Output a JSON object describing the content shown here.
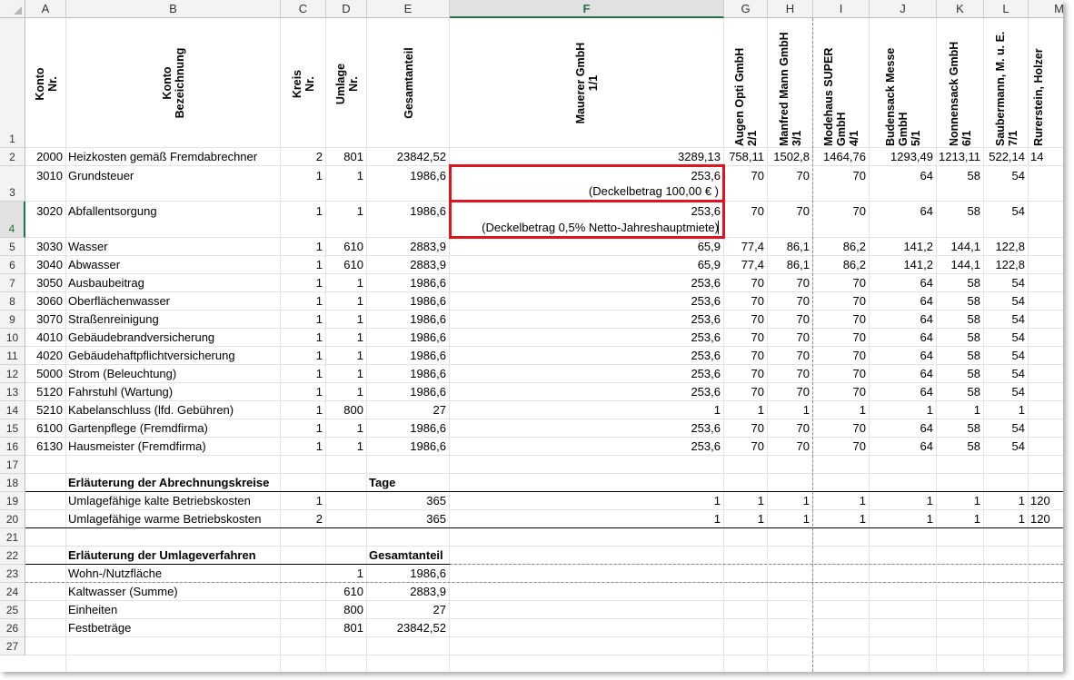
{
  "columns": [
    "A",
    "B",
    "C",
    "D",
    "E",
    "F",
    "G",
    "H",
    "I",
    "J",
    "K",
    "L",
    "M"
  ],
  "row_numbers": [
    "1",
    "2",
    "3",
    "4",
    "5",
    "6",
    "7",
    "8",
    "9",
    "10",
    "11",
    "12",
    "13",
    "14",
    "15",
    "16",
    "17",
    "18",
    "19",
    "20",
    "21",
    "22",
    "23",
    "24",
    "25",
    "26",
    "27"
  ],
  "header_row": {
    "a": "Konto\nNr.",
    "b": "Konto\nBezeichnung",
    "c": "Kreis\nNr.",
    "d": "Umlage\nNr.",
    "e": "Gesamtanteil",
    "f": "Mauerer GmbH\n1/1",
    "g": "Augen Opti GmbH\n2/1",
    "h": "Manfred Mann GmbH\n3/1",
    "i": "Modehaus SUPER\nGmbH\n4/1",
    "j": "Budensack Messe\nGmbH\n5/1",
    "k": "Nonnensack GmbH\n6/1",
    "l": "Saubermann, M. u. E.\n7/1",
    "m": "Rurerstein, Holzer"
  },
  "rows": [
    {
      "n": "2",
      "a": "2000",
      "b": "Heizkosten gemäß Fremdabrechner",
      "c": "2",
      "d": "801",
      "e": "23842,52",
      "f": "3289,13",
      "g": "758,11",
      "h": "1502,8",
      "i": "1464,76",
      "j": "1293,49",
      "k": "1213,11",
      "l": "522,14",
      "m": "14"
    },
    {
      "n": "3",
      "a": "3010",
      "b": "Grundsteuer",
      "c": "1",
      "d": "1",
      "e": "1986,6",
      "f": "253,6",
      "g": "70",
      "h": "70",
      "i": "70",
      "j": "64",
      "k": "58",
      "l": "54",
      "m": "",
      "note": "(Deckelbetrag 100,00 € )"
    },
    {
      "n": "4",
      "a": "3020",
      "b": "Abfallentsorgung",
      "c": "1",
      "d": "1",
      "e": "1986,6",
      "f": "253,6",
      "g": "70",
      "h": "70",
      "i": "70",
      "j": "64",
      "k": "58",
      "l": "54",
      "m": "",
      "note": "(Deckelbetrag 0,5% Netto-Jahreshauptmiete)"
    },
    {
      "n": "5",
      "a": "3030",
      "b": "Wasser",
      "c": "1",
      "d": "610",
      "e": "2883,9",
      "f": "65,9",
      "g": "77,4",
      "h": "86,1",
      "i": "86,2",
      "j": "141,2",
      "k": "144,1",
      "l": "122,8",
      "m": ""
    },
    {
      "n": "6",
      "a": "3040",
      "b": "Abwasser",
      "c": "1",
      "d": "610",
      "e": "2883,9",
      "f": "65,9",
      "g": "77,4",
      "h": "86,1",
      "i": "86,2",
      "j": "141,2",
      "k": "144,1",
      "l": "122,8",
      "m": ""
    },
    {
      "n": "7",
      "a": "3050",
      "b": "Ausbaubeitrag",
      "c": "1",
      "d": "1",
      "e": "1986,6",
      "f": "253,6",
      "g": "70",
      "h": "70",
      "i": "70",
      "j": "64",
      "k": "58",
      "l": "54",
      "m": ""
    },
    {
      "n": "8",
      "a": "3060",
      "b": "Oberflächenwasser",
      "c": "1",
      "d": "1",
      "e": "1986,6",
      "f": "253,6",
      "g": "70",
      "h": "70",
      "i": "70",
      "j": "64",
      "k": "58",
      "l": "54",
      "m": ""
    },
    {
      "n": "9",
      "a": "3070",
      "b": "Straßenreinigung",
      "c": "1",
      "d": "1",
      "e": "1986,6",
      "f": "253,6",
      "g": "70",
      "h": "70",
      "i": "70",
      "j": "64",
      "k": "58",
      "l": "54",
      "m": ""
    },
    {
      "n": "10",
      "a": "4010",
      "b": "Gebäudebrandversicherung",
      "c": "1",
      "d": "1",
      "e": "1986,6",
      "f": "253,6",
      "g": "70",
      "h": "70",
      "i": "70",
      "j": "64",
      "k": "58",
      "l": "54",
      "m": ""
    },
    {
      "n": "11",
      "a": "4020",
      "b": "Gebäudehaftpflichtversicherung",
      "c": "1",
      "d": "1",
      "e": "1986,6",
      "f": "253,6",
      "g": "70",
      "h": "70",
      "i": "70",
      "j": "64",
      "k": "58",
      "l": "54",
      "m": ""
    },
    {
      "n": "12",
      "a": "5000",
      "b": "Strom (Beleuchtung)",
      "c": "1",
      "d": "1",
      "e": "1986,6",
      "f": "253,6",
      "g": "70",
      "h": "70",
      "i": "70",
      "j": "64",
      "k": "58",
      "l": "54",
      "m": ""
    },
    {
      "n": "13",
      "a": "5120",
      "b": "Fahrstuhl (Wartung)",
      "c": "1",
      "d": "1",
      "e": "1986,6",
      "f": "253,6",
      "g": "70",
      "h": "70",
      "i": "70",
      "j": "64",
      "k": "58",
      "l": "54",
      "m": ""
    },
    {
      "n": "14",
      "a": "5210",
      "b": "Kabelanschluss (lfd. Gebühren)",
      "c": "1",
      "d": "800",
      "e": "27",
      "f": "1",
      "g": "1",
      "h": "1",
      "i": "1",
      "j": "1",
      "k": "1",
      "l": "1",
      "m": ""
    },
    {
      "n": "15",
      "a": "6100",
      "b": "Gartenpflege (Fremdfirma)",
      "c": "1",
      "d": "1",
      "e": "1986,6",
      "f": "253,6",
      "g": "70",
      "h": "70",
      "i": "70",
      "j": "64",
      "k": "58",
      "l": "54",
      "m": ""
    },
    {
      "n": "16",
      "a": "6130",
      "b": "Hausmeister (Fremdfirma)",
      "c": "1",
      "d": "1",
      "e": "1986,6",
      "f": "253,6",
      "g": "70",
      "h": "70",
      "i": "70",
      "j": "64",
      "k": "58",
      "l": "54",
      "m": ""
    },
    {
      "n": "17",
      "a": "",
      "b": "",
      "c": "",
      "d": "",
      "e": "",
      "f": "",
      "g": "",
      "h": "",
      "i": "",
      "j": "",
      "k": "",
      "l": "",
      "m": ""
    },
    {
      "n": "18",
      "a": "",
      "b": "Erläuterung der Abrechnungskreise",
      "c": "",
      "d": "",
      "e": "Tage",
      "f": "",
      "g": "",
      "h": "",
      "i": "",
      "j": "",
      "k": "",
      "l": "",
      "m": "",
      "bold": true
    },
    {
      "n": "19",
      "a": "",
      "b": "Umlagefähige kalte Betriebskosten",
      "c": "1",
      "d": "",
      "e": "365",
      "f": "1",
      "g": "1",
      "h": "1",
      "i": "1",
      "j": "1",
      "k": "1",
      "l": "1",
      "m": "120"
    },
    {
      "n": "20",
      "a": "",
      "b": "Umlagefähige warme Betriebskosten",
      "c": "2",
      "d": "",
      "e": "365",
      "f": "1",
      "g": "1",
      "h": "1",
      "i": "1",
      "j": "1",
      "k": "1",
      "l": "1",
      "m": "120"
    },
    {
      "n": "21",
      "a": "",
      "b": "",
      "c": "",
      "d": "",
      "e": "",
      "f": "",
      "g": "",
      "h": "",
      "i": "",
      "j": "",
      "k": "",
      "l": "",
      "m": ""
    },
    {
      "n": "22",
      "a": "",
      "b": "Erläuterung der Umlageverfahren",
      "c": "",
      "d": "",
      "e": "Gesamtanteil",
      "f": "",
      "g": "",
      "h": "",
      "i": "",
      "j": "",
      "k": "",
      "l": "",
      "m": "",
      "bold": true
    },
    {
      "n": "23",
      "a": "",
      "b": "Wohn-/Nutzfläche",
      "c": "",
      "d": "1",
      "e": "1986,6",
      "f": "",
      "g": "",
      "h": "",
      "i": "",
      "j": "",
      "k": "",
      "l": "",
      "m": ""
    },
    {
      "n": "24",
      "a": "",
      "b": "Kaltwasser (Summe)",
      "c": "",
      "d": "610",
      "e": "2883,9",
      "f": "",
      "g": "",
      "h": "",
      "i": "",
      "j": "",
      "k": "",
      "l": "",
      "m": ""
    },
    {
      "n": "25",
      "a": "",
      "b": "Einheiten",
      "c": "",
      "d": "800",
      "e": "27",
      "f": "",
      "g": "",
      "h": "",
      "i": "",
      "j": "",
      "k": "",
      "l": "",
      "m": ""
    },
    {
      "n": "26",
      "a": "",
      "b": "Festbeträge",
      "c": "",
      "d": "801",
      "e": "23842,52",
      "f": "",
      "g": "",
      "h": "",
      "i": "",
      "j": "",
      "k": "",
      "l": "",
      "m": ""
    },
    {
      "n": "27",
      "a": "",
      "b": "",
      "c": "",
      "d": "",
      "e": "",
      "f": "",
      "g": "",
      "h": "",
      "i": "",
      "j": "",
      "k": "",
      "l": "",
      "m": ""
    }
  ],
  "selected_column": "F",
  "selected_row": "4",
  "colors": {
    "selection_red": "#e0141e",
    "excel_green": "#217346"
  }
}
